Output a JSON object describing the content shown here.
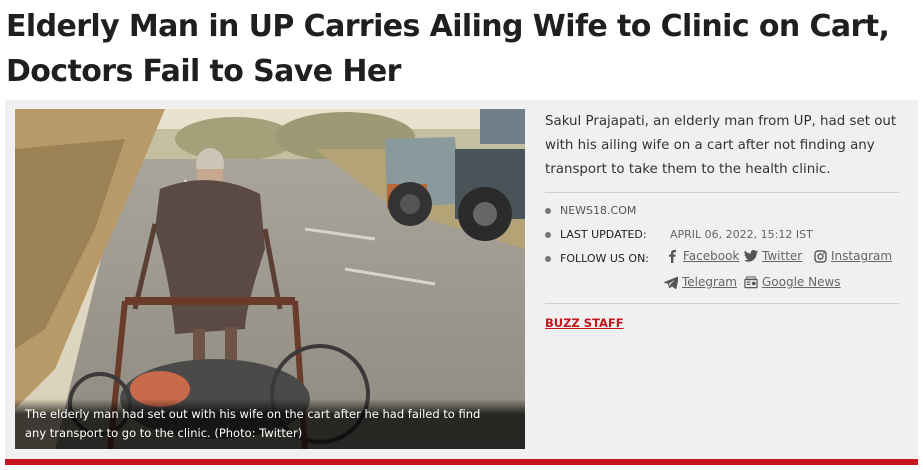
{
  "article": {
    "headline": "Elderly Man in UP Carries Ailing Wife to Clinic on Cart, Doctors Fail to Save Her",
    "summary": "Sakul Prajapati, an elderly man from UP, had set out with his ailing wife on a cart after not finding any transport to take them to the health clinic.",
    "image_caption": "The elderly man had set out with his wife on the cart after he had failed to find any transport to go to the clinic. (Photo: Twitter)"
  },
  "meta": {
    "source": "NEWS18.COM",
    "last_updated_label": "LAST UPDATED:",
    "last_updated_value": "APRIL 06, 2022, 15:12 IST",
    "follow_label": "FOLLOW US ON:",
    "social": {
      "facebook": "Facebook",
      "twitter": "Twitter",
      "instagram": "Instagram",
      "telegram": "Telegram",
      "google_news": "Google News"
    },
    "author": "BUZZ STAFF"
  },
  "colors": {
    "accent_red": "#c8161e",
    "panel_bg": "#f0f0f0"
  },
  "icons": [
    "facebook-icon",
    "twitter-icon",
    "instagram-icon",
    "telegram-icon",
    "google-news-icon"
  ]
}
